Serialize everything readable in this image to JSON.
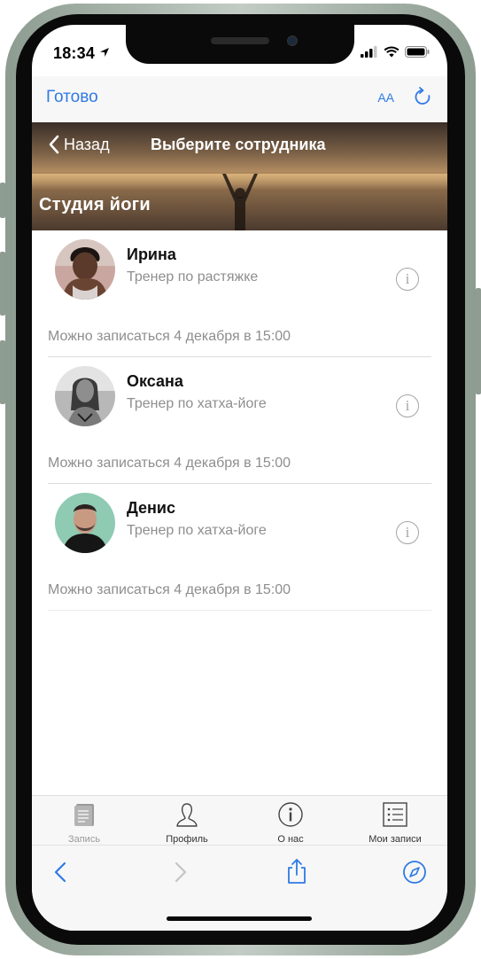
{
  "status_bar": {
    "time": "18:34"
  },
  "browser": {
    "done_label": "Готово",
    "text_size_label": "AA"
  },
  "header": {
    "back_label": "Назад",
    "title": "Выберите сотрудника",
    "studio_name": "Студия йоги"
  },
  "employees": [
    {
      "name": "Ирина",
      "role": "Тренер по растяжке",
      "availability": "Можно записаться 4 декабря в 15:00"
    },
    {
      "name": "Оксана",
      "role": "Тренер по хатха-йоге",
      "availability": "Можно записаться 4 декабря в 15:00"
    },
    {
      "name": "Денис",
      "role": "Тренер по хатха-йоге",
      "availability": "Можно записаться 4 декабря в 15:00"
    }
  ],
  "tabs": [
    {
      "label": "Запись",
      "icon": "book-icon",
      "active": false
    },
    {
      "label": "Профиль",
      "icon": "person-icon",
      "active": true
    },
    {
      "label": "О нас",
      "icon": "info-icon",
      "active": true
    },
    {
      "label": "Мои записи",
      "icon": "list-icon",
      "active": true
    }
  ],
  "colors": {
    "accent": "#2f7ae5",
    "frame": "#a9b6ac",
    "muted_text": "#8e8e8e"
  }
}
